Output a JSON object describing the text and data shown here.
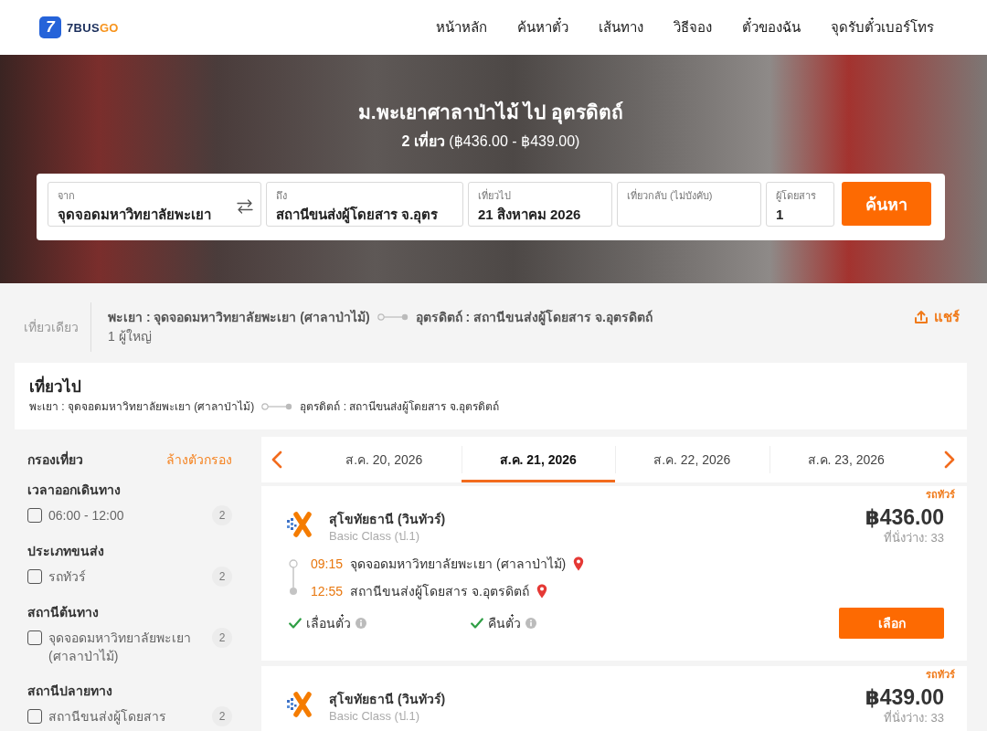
{
  "header": {
    "logo": {
      "mark": "7",
      "name": "7BUS",
      "accent": "GO"
    },
    "nav": [
      "หน้าหลัก",
      "ค้นหาตั๋ว",
      "เส้นทาง",
      "วิธีจอง",
      "ตั๋วของฉัน",
      "จุดรับตั๋วเบอร์โทร"
    ]
  },
  "hero": {
    "title": "ม.พะเยาศาลาป่าไม้ ไป อุตรดิตถ์",
    "subtitle": "**2 เที่ยว** (฿436.00 - ฿439.00)"
  },
  "search_form": {
    "fields": [
      {
        "label": "จาก",
        "value": "จุดจอดมหาวิทยาลัยพะเยา",
        "swap": true
      },
      {
        "label": "ถึง",
        "value": "สถานีขนส่งผู้โดยสาร จ.อุตร",
        "swap": false
      },
      {
        "label": "เที่ยวไป",
        "value": "21 สิงหาคม 2026",
        "swap": false
      },
      {
        "label": "เที่ยวกลับ (ไม่บังคับ)",
        "swap": false
      },
      {
        "label": "ผู้โดยสาร",
        "value": "1",
        "swap": false
      }
    ],
    "button": "ค้นหา"
  },
  "trip_summary": {
    "trip_type": "เที่ยวเดียว",
    "origin": "พะเยา : จุดจอดมหาวิทยาลัยพะเยา (ศาลาป่าไม้)",
    "destination": "อุตรดิตถ์ : สถานีขนส่งผู้โดยสาร จ.อุตรดิตถ์",
    "passengers": "1 ผู้ใหญ่",
    "share": "แชร์"
  },
  "outbound": {
    "title": "เที่ยวไป",
    "origin": "พะเยา : จุดจอดมหาวิทยาลัยพะเยา (ศาลาป่าไม้)",
    "destination": "อุตรดิตถ์ : สถานีขนส่งผู้โดยสาร จ.อุตรดิตถ์"
  },
  "filters": {
    "title": "กรองเที่ยว",
    "clear": "ล้างตัวกรอง",
    "groups": [
      {
        "title": "เวลาออกเดินทาง",
        "options": [
          {
            "label": "06:00 - 12:00",
            "count": "2",
            "checked": false
          }
        ]
      },
      {
        "title": "ประเภทขนส่ง",
        "options": [
          {
            "label": "รถทัวร์",
            "count": "2",
            "checked": false
          }
        ]
      },
      {
        "title": "สถานีต้นทาง",
        "options": [
          {
            "label": "จุดจอดมหาวิทยาลัยพะเยา (ศาลาป่าไม้)",
            "count": "2",
            "checked": false
          }
        ]
      },
      {
        "title": "สถานีปลายทาง",
        "options": [
          {
            "label": "สถานีขนส่งผู้โดยสาร",
            "count": "2",
            "checked": false
          }
        ]
      }
    ]
  },
  "date_tabs": [
    {
      "label": "ส.ค. 20, 2026",
      "selected": false
    },
    {
      "label": "ส.ค. 21, 2026",
      "selected": true
    },
    {
      "label": "ส.ค. 22, 2026",
      "selected": false
    },
    {
      "label": "ส.ค. 23, 2026",
      "selected": false
    }
  ],
  "trips": [
    {
      "type": "รถทัวร์",
      "operator": "สุโขทัยธานี (วินทัวร์)",
      "bus_class": "Basic Class (ป.1)",
      "price": "฿436.00",
      "seats": "ที่นั่งว่าง: 33",
      "stops": [
        {
          "time": "09:15",
          "station": "จุดจอดมหาวิทยาลัยพะเยา (ศาลาป่าไม้)"
        },
        {
          "time": "12:55",
          "station": "สถานีขนส่งผู้โดยสาร จ.อุตรดิตถ์"
        }
      ],
      "features": [
        {
          "label": "เลื่อนตั๋ว",
          "available": true
        },
        {
          "label": "คืนตั๋ว",
          "available": true
        }
      ],
      "button": "เลือก"
    },
    {
      "type": "รถทัวร์",
      "operator": "สุโขทัยธานี (วินทัวร์)",
      "bus_class": "Basic Class (ป.1)",
      "price": "฿439.00",
      "seats": "ที่นั่งว่าง: 33"
    }
  ]
}
